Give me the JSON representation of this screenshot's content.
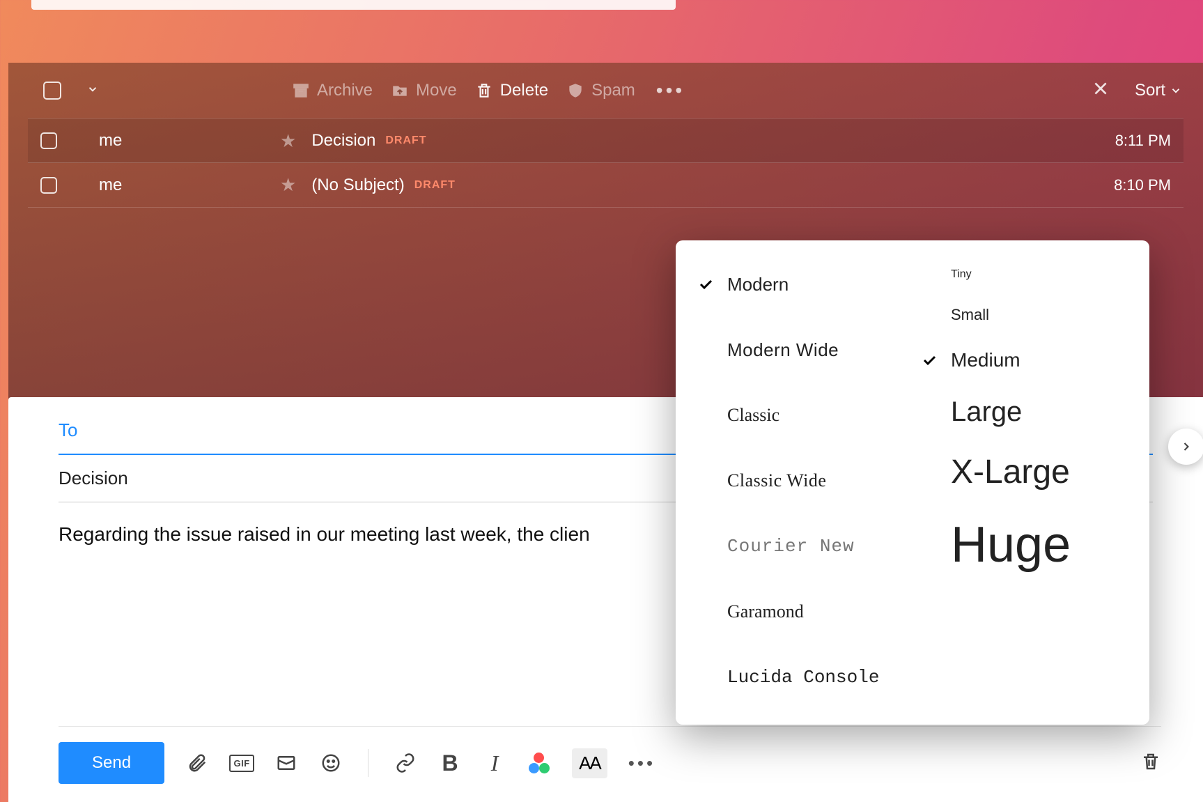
{
  "toolbar": {
    "archive": "Archive",
    "move": "Move",
    "delete": "Delete",
    "spam": "Spam",
    "sort": "Sort"
  },
  "messages": [
    {
      "sender": "me",
      "subject": "Decision",
      "badge": "DRAFT",
      "time": "8:11 PM",
      "selected": true
    },
    {
      "sender": "me",
      "subject": "(No Subject)",
      "badge": "DRAFT",
      "time": "8:10 PM",
      "selected": false
    }
  ],
  "compose": {
    "to_label": "To",
    "subject": "Decision",
    "body": "Regarding the issue raised in our meeting last week, the clien",
    "send": "Send",
    "gif": "GIF",
    "font_button": "AA"
  },
  "font_popup": {
    "families": [
      {
        "name": "Modern",
        "class": "ff-modern",
        "selected": true
      },
      {
        "name": "Modern Wide",
        "class": "ff-modernwide",
        "selected": false
      },
      {
        "name": "Classic",
        "class": "ff-classic",
        "selected": false
      },
      {
        "name": "Classic Wide",
        "class": "ff-classicwide",
        "selected": false
      },
      {
        "name": "Courier New",
        "class": "ff-courier",
        "selected": false
      },
      {
        "name": "Garamond",
        "class": "ff-garamond",
        "selected": false
      },
      {
        "name": "Lucida Console",
        "class": "ff-lucida",
        "selected": false
      }
    ],
    "sizes": [
      {
        "name": "Tiny",
        "class": "sz-tiny",
        "selected": false
      },
      {
        "name": "Small",
        "class": "sz-small",
        "selected": false
      },
      {
        "name": "Medium",
        "class": "sz-medium",
        "selected": true
      },
      {
        "name": "Large",
        "class": "sz-large",
        "selected": false
      },
      {
        "name": "X-Large",
        "class": "sz-xl",
        "selected": false
      },
      {
        "name": "Huge",
        "class": "sz-huge",
        "selected": false
      }
    ]
  }
}
